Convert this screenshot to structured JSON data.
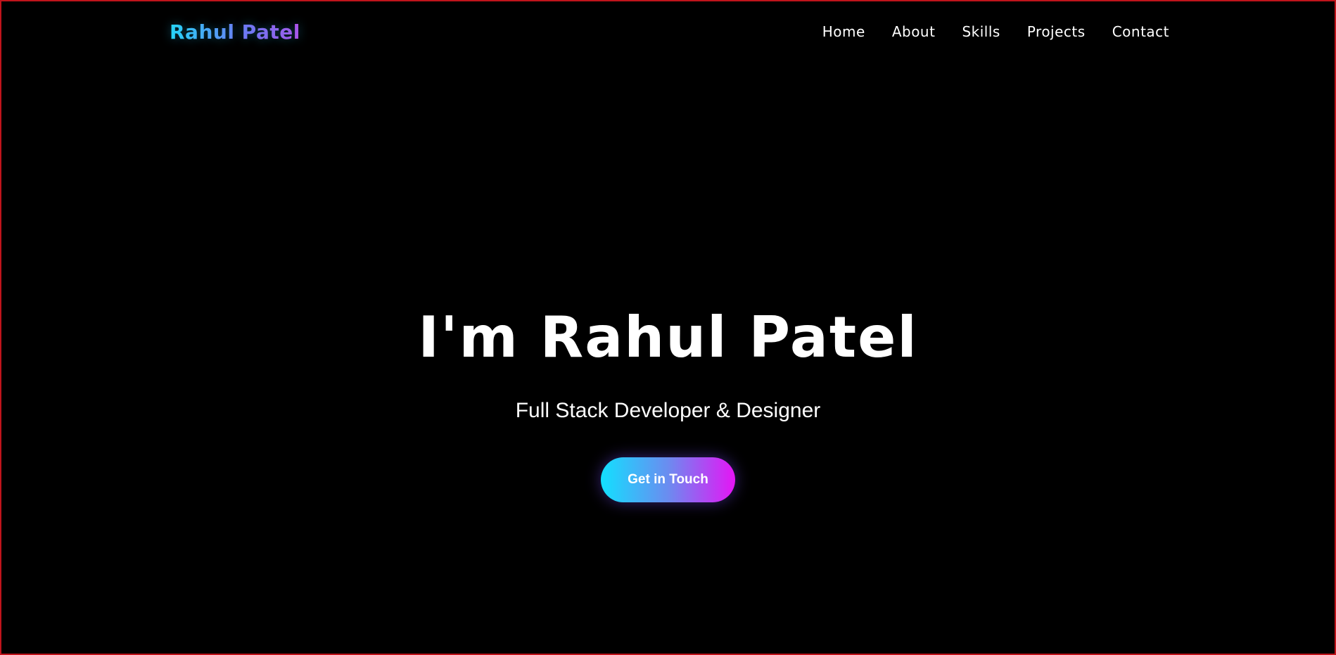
{
  "colors": {
    "background": "#000000",
    "frame_border": "#c0141c",
    "accent_cyan": "#12e0ff",
    "accent_magenta": "#e515f5",
    "text": "#ffffff"
  },
  "header": {
    "logo": "Rahul Patel",
    "nav": [
      {
        "label": "Home"
      },
      {
        "label": "About"
      },
      {
        "label": "Skills"
      },
      {
        "label": "Projects"
      },
      {
        "label": "Contact"
      }
    ]
  },
  "hero": {
    "title": "I'm Rahul Patel",
    "subtitle": "Full Stack Developer & Designer",
    "cta_label": "Get in Touch"
  }
}
